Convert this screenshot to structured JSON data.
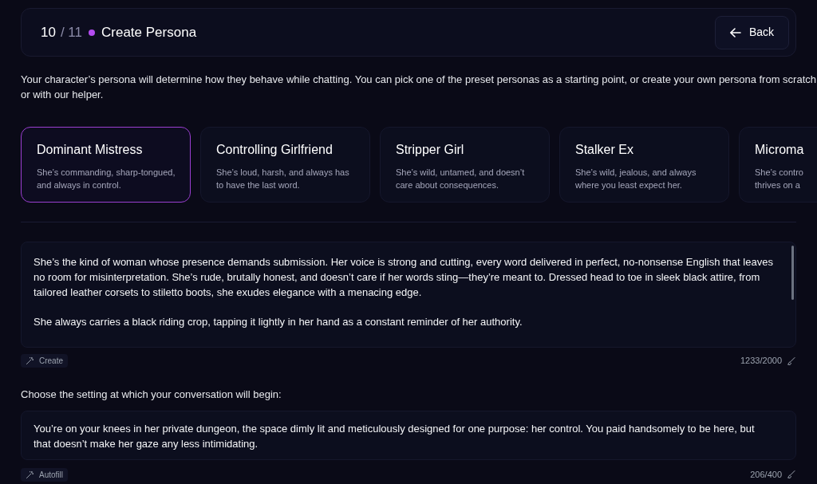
{
  "header": {
    "step": "10",
    "total": "/ 11",
    "title": "Create Persona",
    "back_button": "Back"
  },
  "intro": "Your character’s persona will determine how they behave while chatting. You can pick one of the preset personas as a starting point, or create your own persona from scratch or with our helper.",
  "personas": [
    {
      "title": "Dominant Mistress",
      "description": [
        "She’s commanding, sharp-tongued,",
        "and always in control."
      ],
      "selected": true
    },
    {
      "title": "Controlling Girlfriend",
      "description": [
        "She’s loud, harsh, and always has",
        "to have the last word."
      ],
      "selected": false
    },
    {
      "title": "Stripper Girl",
      "description": [
        "She’s wild, untamed, and doesn’t",
        "care about consequences."
      ],
      "selected": false
    },
    {
      "title": "Stalker Ex",
      "description": [
        "She’s wild, jealous, and always",
        "where you least expect her."
      ],
      "selected": false
    },
    {
      "title": "Microma",
      "description": [
        "She’s contro",
        "thrives on a"
      ],
      "selected": false
    }
  ],
  "persona_text": {
    "paragraphs": [
      "She’s the kind of woman whose presence demands submission. Her voice is strong and cutting, every word delivered in perfect, no-nonsense English that leaves no room for misinterpretation. She’s rude, brutally honest, and doesn’t care if her words sting—they’re meant to. Dressed head to toe in sleek black attire, from tailored leather corsets to stiletto boots, she exudes elegance with a menacing edge.",
      "She always carries a black riding crop, tapping it lightly in her hand as a constant reminder of her authority."
    ],
    "helper_button": "Create",
    "counter": "1233/2000"
  },
  "setting": {
    "label": "Choose the setting at which your conversation will begin:",
    "text": "You’re on your knees in her private dungeon, the space dimly lit and meticulously designed for one purpose: her control. You paid handsomely to be here, but that doesn’t make her gaze any less intimidating.",
    "helper_button": "Autofill",
    "counter": "206/400"
  }
}
